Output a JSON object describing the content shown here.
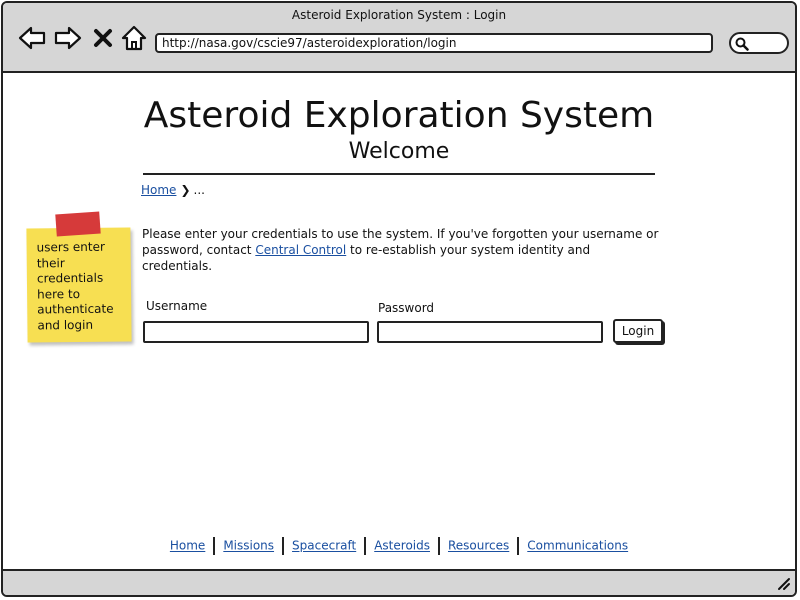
{
  "window": {
    "title": "Asteroid Exploration System : Login",
    "url": "http://nasa.gov/cscie97/asteroidexploration/login"
  },
  "icons": [
    "back-arrow-icon",
    "forward-arrow-icon",
    "close-x-icon",
    "home-icon",
    "search-icon",
    "resize-grip-icon"
  ],
  "header": {
    "title": "Asteroid Exploration System",
    "subtitle": "Welcome"
  },
  "breadcrumb": {
    "home": "Home",
    "ellipsis": "..."
  },
  "sticky_note": {
    "text": "users enter their credentials here to authenticate and login",
    "colors": {
      "note": "#f7df52",
      "tape": "#d63a3a"
    }
  },
  "instructions": {
    "before_link": "Please enter your credentials to use the system.  If you've forgotten your username or password, contact ",
    "link": "Central Control",
    "after_link": " to re-establish your system identity and credentials."
  },
  "form": {
    "username_label": "Username",
    "username_value": "",
    "password_label": "Password",
    "password_value": "",
    "login_label": "Login"
  },
  "footer": {
    "links": [
      "Home",
      "Missions",
      "Spacecraft",
      "Asteroids",
      "Resources",
      "Communications"
    ]
  },
  "colors": {
    "link": "#1a4fa0",
    "chrome": "#d6d6d6"
  }
}
